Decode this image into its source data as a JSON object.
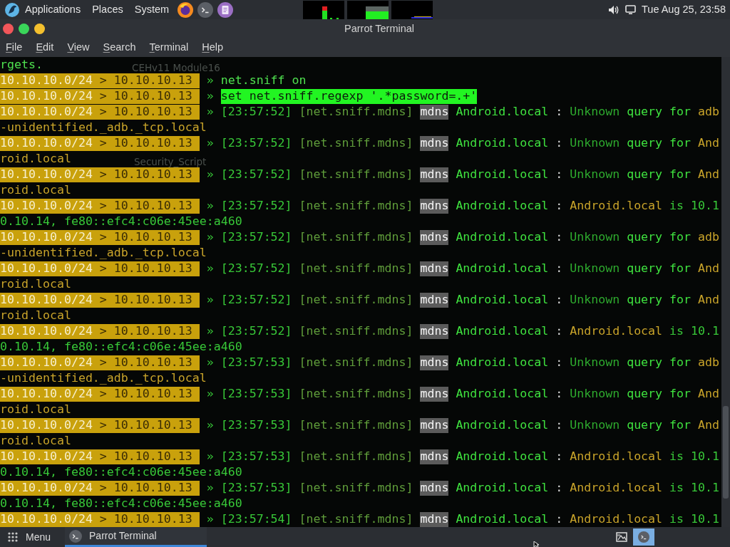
{
  "top_panel": {
    "menus": [
      "Applications",
      "Places",
      "System"
    ],
    "clock": "Tue Aug 25, 23:58"
  },
  "window": {
    "title": "Parrot Terminal",
    "menu": [
      "File",
      "Edit",
      "View",
      "Search",
      "Terminal",
      "Help"
    ]
  },
  "desktop_labels": [
    "CEHv11 Module16",
    "Security_Script"
  ],
  "terminal": {
    "lines": [
      {
        "kind": "output",
        "text": "rgets."
      },
      {
        "kind": "command",
        "subnet": "10.10.10.0/24",
        "target": "> 10.10.10.13",
        "arrow": "»",
        "command": "net.sniff on",
        "highlighted": false
      },
      {
        "kind": "command",
        "subnet": "10.10.10.0/24",
        "target": "> 10.10.10.13",
        "arrow": "»",
        "command": "set net.sniff.regexp '.*password=.+'",
        "highlighted": true
      },
      {
        "kind": "event",
        "subnet": "10.10.10.0/24",
        "target": "> 10.10.10.13",
        "arrow": "»",
        "time": "[23:57:52]",
        "module": "[net.sniff.mdns]",
        "tag": "mdns",
        "source": "Android.local",
        "sep": ":",
        "message": [
          {
            "kind": "dim",
            "text": "Unknown"
          },
          {
            "kind": "bright",
            "text": "query for"
          },
          {
            "kind": "warn",
            "text": "adb"
          }
        ]
      },
      {
        "kind": "wrap",
        "message": [
          {
            "kind": "warn",
            "text": "-unidentified._adb._tcp.local"
          }
        ]
      },
      {
        "kind": "event",
        "subnet": "10.10.10.0/24",
        "target": "> 10.10.10.13",
        "arrow": "»",
        "time": "[23:57:52]",
        "module": "[net.sniff.mdns]",
        "tag": "mdns",
        "source": "Android.local",
        "sep": ":",
        "message": [
          {
            "kind": "dim",
            "text": "Unknown"
          },
          {
            "kind": "bright",
            "text": "query for"
          },
          {
            "kind": "warn",
            "text": "And"
          }
        ]
      },
      {
        "kind": "wrap",
        "message": [
          {
            "kind": "warn",
            "text": "roid.local"
          }
        ]
      },
      {
        "kind": "event",
        "subnet": "10.10.10.0/24",
        "target": "> 10.10.10.13",
        "arrow": "»",
        "time": "[23:57:52]",
        "module": "[net.sniff.mdns]",
        "tag": "mdns",
        "source": "Android.local",
        "sep": ":",
        "message": [
          {
            "kind": "dim",
            "text": "Unknown"
          },
          {
            "kind": "bright",
            "text": "query for"
          },
          {
            "kind": "warn",
            "text": "And"
          }
        ]
      },
      {
        "kind": "wrap",
        "message": [
          {
            "kind": "warn",
            "text": "roid.local"
          }
        ]
      },
      {
        "kind": "event",
        "subnet": "10.10.10.0/24",
        "target": "> 10.10.10.13",
        "arrow": "»",
        "time": "[23:57:52]",
        "module": "[net.sniff.mdns]",
        "tag": "mdns",
        "source": "Android.local",
        "sep": ":",
        "message": [
          {
            "kind": "warn",
            "text": "Android.local"
          },
          {
            "kind": "green",
            "text": "is 10.1"
          }
        ]
      },
      {
        "kind": "wrap",
        "message": [
          {
            "kind": "green",
            "text": "0.10.14, fe80::efc4:c06e:45ee:a460"
          }
        ]
      },
      {
        "kind": "event",
        "subnet": "10.10.10.0/24",
        "target": "> 10.10.10.13",
        "arrow": "»",
        "time": "[23:57:52]",
        "module": "[net.sniff.mdns]",
        "tag": "mdns",
        "source": "Android.local",
        "sep": ":",
        "message": [
          {
            "kind": "dim",
            "text": "Unknown"
          },
          {
            "kind": "bright",
            "text": "query for"
          },
          {
            "kind": "warn",
            "text": "adb"
          }
        ]
      },
      {
        "kind": "wrap",
        "message": [
          {
            "kind": "warn",
            "text": "-unidentified._adb._tcp.local"
          }
        ]
      },
      {
        "kind": "event",
        "subnet": "10.10.10.0/24",
        "target": "> 10.10.10.13",
        "arrow": "»",
        "time": "[23:57:52]",
        "module": "[net.sniff.mdns]",
        "tag": "mdns",
        "source": "Android.local",
        "sep": ":",
        "message": [
          {
            "kind": "dim",
            "text": "Unknown"
          },
          {
            "kind": "bright",
            "text": "query for"
          },
          {
            "kind": "warn",
            "text": "And"
          }
        ]
      },
      {
        "kind": "wrap",
        "message": [
          {
            "kind": "warn",
            "text": "roid.local"
          }
        ]
      },
      {
        "kind": "event",
        "subnet": "10.10.10.0/24",
        "target": "> 10.10.10.13",
        "arrow": "»",
        "time": "[23:57:52]",
        "module": "[net.sniff.mdns]",
        "tag": "mdns",
        "source": "Android.local",
        "sep": ":",
        "message": [
          {
            "kind": "dim",
            "text": "Unknown"
          },
          {
            "kind": "bright",
            "text": "query for"
          },
          {
            "kind": "warn",
            "text": "And"
          }
        ]
      },
      {
        "kind": "wrap",
        "message": [
          {
            "kind": "warn",
            "text": "roid.local"
          }
        ]
      },
      {
        "kind": "event",
        "subnet": "10.10.10.0/24",
        "target": "> 10.10.10.13",
        "arrow": "»",
        "time": "[23:57:52]",
        "module": "[net.sniff.mdns]",
        "tag": "mdns",
        "source": "Android.local",
        "sep": ":",
        "message": [
          {
            "kind": "warn",
            "text": "Android.local"
          },
          {
            "kind": "green",
            "text": "is 10.1"
          }
        ]
      },
      {
        "kind": "wrap",
        "message": [
          {
            "kind": "green",
            "text": "0.10.14, fe80::efc4:c06e:45ee:a460"
          }
        ]
      },
      {
        "kind": "event",
        "subnet": "10.10.10.0/24",
        "target": "> 10.10.10.13",
        "arrow": "»",
        "time": "[23:57:53]",
        "module": "[net.sniff.mdns]",
        "tag": "mdns",
        "source": "Android.local",
        "sep": ":",
        "message": [
          {
            "kind": "dim",
            "text": "Unknown"
          },
          {
            "kind": "bright",
            "text": "query for"
          },
          {
            "kind": "warn",
            "text": "adb"
          }
        ]
      },
      {
        "kind": "wrap",
        "message": [
          {
            "kind": "warn",
            "text": "-unidentified._adb._tcp.local"
          }
        ]
      },
      {
        "kind": "event",
        "subnet": "10.10.10.0/24",
        "target": "> 10.10.10.13",
        "arrow": "»",
        "time": "[23:57:53]",
        "module": "[net.sniff.mdns]",
        "tag": "mdns",
        "source": "Android.local",
        "sep": ":",
        "message": [
          {
            "kind": "dim",
            "text": "Unknown"
          },
          {
            "kind": "bright",
            "text": "query for"
          },
          {
            "kind": "warn",
            "text": "And"
          }
        ]
      },
      {
        "kind": "wrap",
        "message": [
          {
            "kind": "warn",
            "text": "roid.local"
          }
        ]
      },
      {
        "kind": "event",
        "subnet": "10.10.10.0/24",
        "target": "> 10.10.10.13",
        "arrow": "»",
        "time": "[23:57:53]",
        "module": "[net.sniff.mdns]",
        "tag": "mdns",
        "source": "Android.local",
        "sep": ":",
        "message": [
          {
            "kind": "dim",
            "text": "Unknown"
          },
          {
            "kind": "bright",
            "text": "query for"
          },
          {
            "kind": "warn",
            "text": "And"
          }
        ]
      },
      {
        "kind": "wrap",
        "message": [
          {
            "kind": "warn",
            "text": "roid.local"
          }
        ]
      },
      {
        "kind": "event",
        "subnet": "10.10.10.0/24",
        "target": "> 10.10.10.13",
        "arrow": "»",
        "time": "[23:57:53]",
        "module": "[net.sniff.mdns]",
        "tag": "mdns",
        "source": "Android.local",
        "sep": ":",
        "message": [
          {
            "kind": "warn",
            "text": "Android.local"
          },
          {
            "kind": "green",
            "text": "is 10.1"
          }
        ]
      },
      {
        "kind": "wrap",
        "message": [
          {
            "kind": "green",
            "text": "0.10.14, fe80::efc4:c06e:45ee:a460"
          }
        ]
      },
      {
        "kind": "event",
        "subnet": "10.10.10.0/24",
        "target": "> 10.10.10.13",
        "arrow": "»",
        "time": "[23:57:53]",
        "module": "[net.sniff.mdns]",
        "tag": "mdns",
        "source": "Android.local",
        "sep": ":",
        "message": [
          {
            "kind": "warn",
            "text": "Android.local"
          },
          {
            "kind": "green",
            "text": "is 10.1"
          }
        ]
      },
      {
        "kind": "wrap",
        "message": [
          {
            "kind": "green",
            "text": "0.10.14, fe80::efc4:c06e:45ee:a460"
          }
        ]
      },
      {
        "kind": "event",
        "subnet": "10.10.10.0/24",
        "target": "> 10.10.10.13",
        "arrow": "»",
        "time": "[23:57:54]",
        "module": "[net.sniff.mdns]",
        "tag": "mdns",
        "source": "Android.local",
        "sep": ":",
        "message": [
          {
            "kind": "warn",
            "text": "Android.local"
          },
          {
            "kind": "green",
            "text": "is 10.1"
          }
        ]
      }
    ]
  },
  "taskbar": {
    "menu_label": "Menu",
    "tasks": [
      {
        "label": "Parrot Terminal",
        "selected": true
      }
    ]
  }
}
